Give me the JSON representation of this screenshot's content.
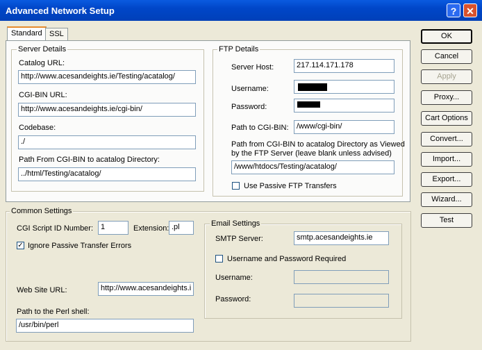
{
  "window": {
    "title": "Advanced Network Setup",
    "help_glyph": "?",
    "close_glyph": "✕"
  },
  "tabs": [
    {
      "label": "Standard",
      "active": true
    },
    {
      "label": "SSL",
      "active": false
    }
  ],
  "server_details": {
    "legend": "Server Details",
    "catalog_url_label": "Catalog URL:",
    "catalog_url": "http://www.acesandeights.ie/Testing/acatalog/",
    "cgi_bin_url_label": "CGI-BIN URL:",
    "cgi_bin_url": "http://www.acesandeights.ie/cgi-bin/",
    "codebase_label": "Codebase:",
    "codebase": "./",
    "path_from_cgi_label": "Path From CGI-BIN to acatalog Directory:",
    "path_from_cgi": "../html/Testing/acatalog/"
  },
  "ftp_details": {
    "legend": "FTP Details",
    "server_host_label": "Server Host:",
    "server_host": "217.114.171.178",
    "username_label": "Username:",
    "password_label": "Password:",
    "path_to_cgi_label": "Path to CGI-BIN:",
    "path_to_cgi": "/www/cgi-bin/",
    "path_from_cgi_ftp_label_1": "Path from CGI-BIN to acatalog Directory as Viewed",
    "path_from_cgi_ftp_label_2": "by the FTP Server (leave blank unless advised)",
    "path_from_cgi_ftp": "/www/htdocs/Testing/acatalog/",
    "passive_label": "Use Passive FTP Transfers",
    "passive_checked": false
  },
  "common_settings": {
    "legend": "Common Settings",
    "cgi_script_id_label": "CGI Script ID Number:",
    "cgi_script_id": "1",
    "extension_label": "Extension:",
    "extension": ".pl",
    "ignore_passive_label": "Ignore Passive Transfer Errors",
    "ignore_passive_checked": true,
    "check_glyph": "✓",
    "website_url_label": "Web Site URL:",
    "website_url": "http://www.acesandeights.i",
    "perl_path_label": "Path to the Perl shell:",
    "perl_path": "/usr/bin/perl"
  },
  "email_settings": {
    "legend": "Email Settings",
    "smtp_label": "SMTP Server:",
    "smtp": "smtp.acesandeights.ie",
    "auth_required_label": "Username and Password Required",
    "auth_required_checked": false,
    "username_label": "Username:",
    "password_label": "Password:"
  },
  "buttons": {
    "ok": "OK",
    "cancel": "Cancel",
    "apply": "Apply",
    "proxy": "Proxy...",
    "cart_options": "Cart Options",
    "convert": "Convert...",
    "import": "Import...",
    "export": "Export...",
    "wizard": "Wizard...",
    "test": "Test"
  }
}
